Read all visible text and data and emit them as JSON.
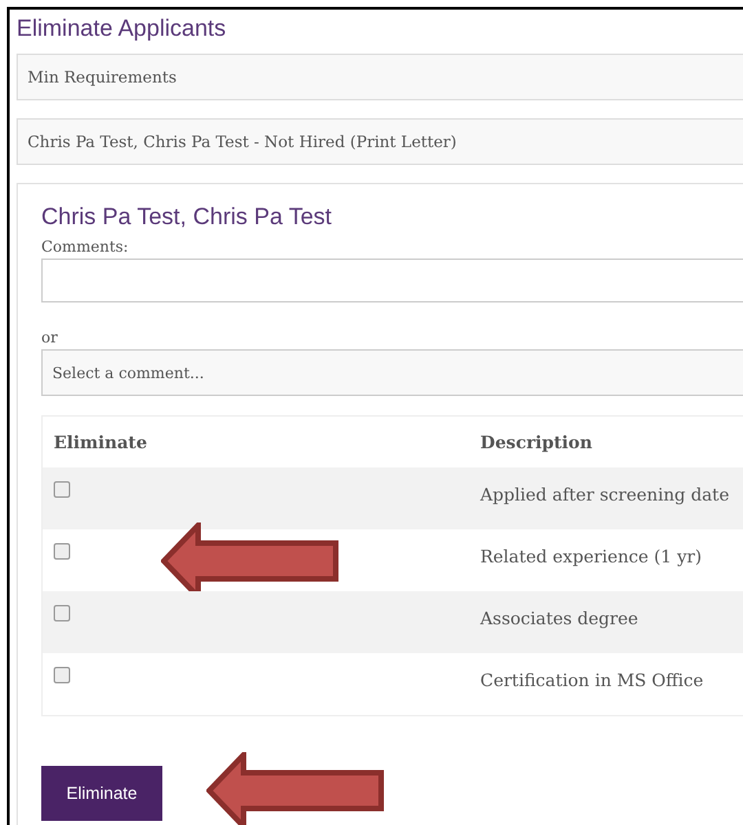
{
  "page": {
    "title": "Eliminate Applicants"
  },
  "panels": [
    {
      "label": "Min Requirements"
    },
    {
      "label": "Chris Pa Test, Chris Pa Test - Not Hired (Print Letter)"
    }
  ],
  "card": {
    "title": "Chris Pa Test, Chris Pa Test",
    "comments_label": "Comments:",
    "or_label": "or",
    "select": {
      "placeholder": "Select a comment..."
    },
    "table": {
      "columns": [
        "Eliminate",
        "Description"
      ],
      "rows": [
        {
          "checked": false,
          "description": "Applied after screening date",
          "highlighted": false
        },
        {
          "checked": false,
          "description": "Related experience (1 yr)",
          "highlighted": true
        },
        {
          "checked": false,
          "description": "Associates degree",
          "highlighted": false
        },
        {
          "checked": false,
          "description": "Certification in MS Office",
          "highlighted": false
        }
      ]
    },
    "button": {
      "label": "Eliminate",
      "highlighted": true
    }
  }
}
